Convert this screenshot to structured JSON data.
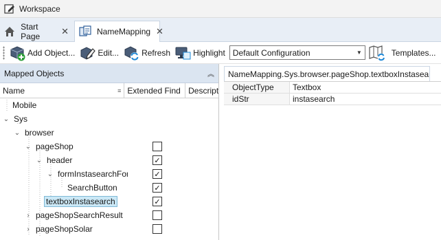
{
  "window": {
    "title": "Workspace"
  },
  "tabs": [
    {
      "label": "Start Page",
      "icon": "home-icon"
    },
    {
      "label": "NameMapping",
      "icon": "namemapping-icon"
    }
  ],
  "toolbar": {
    "add_object_label": "Add Object...",
    "edit_label": "Edit...",
    "refresh_label": "Refresh",
    "highlight_label": "Highlight",
    "configuration_value": "Default Configuration",
    "templates_label": "Templates..."
  },
  "left_panel": {
    "title": "Mapped Objects",
    "columns": [
      "Name",
      "Extended Find",
      "Descript"
    ]
  },
  "tree": [
    {
      "label": "Mobile",
      "expander": "",
      "checkbox": null
    },
    {
      "label": "Sys",
      "expander": "⌄",
      "checkbox": null
    },
    {
      "label": "browser",
      "expander": "⌄",
      "checkbox": null
    },
    {
      "label": "pageShop",
      "expander": "⌄",
      "checkbox": false
    },
    {
      "label": "header",
      "expander": "⌄",
      "checkbox": true
    },
    {
      "label": "formInstasearchForm",
      "expander": "⌄",
      "checkbox": true
    },
    {
      "label": "SearchButton",
      "expander": "",
      "checkbox": true
    },
    {
      "label": "textboxInstasearch",
      "expander": "",
      "checkbox": true,
      "selected": true
    },
    {
      "label": "pageShopSearchResult",
      "expander": "›",
      "checkbox": false
    },
    {
      "label": "pageShopSolar",
      "expander": "›",
      "checkbox": false
    }
  ],
  "right_panel": {
    "path_tab": "NameMapping.Sys.browser.pageShop.textboxInstasearch",
    "properties": [
      {
        "key": "ObjectType",
        "value": "Textbox"
      },
      {
        "key": "idStr",
        "value": "instasearch"
      }
    ]
  },
  "colors": {
    "panel_header_bg": "#dbe5f1",
    "selection_bg": "#cbe8f6",
    "tabbar_bg": "#e8eef6"
  }
}
